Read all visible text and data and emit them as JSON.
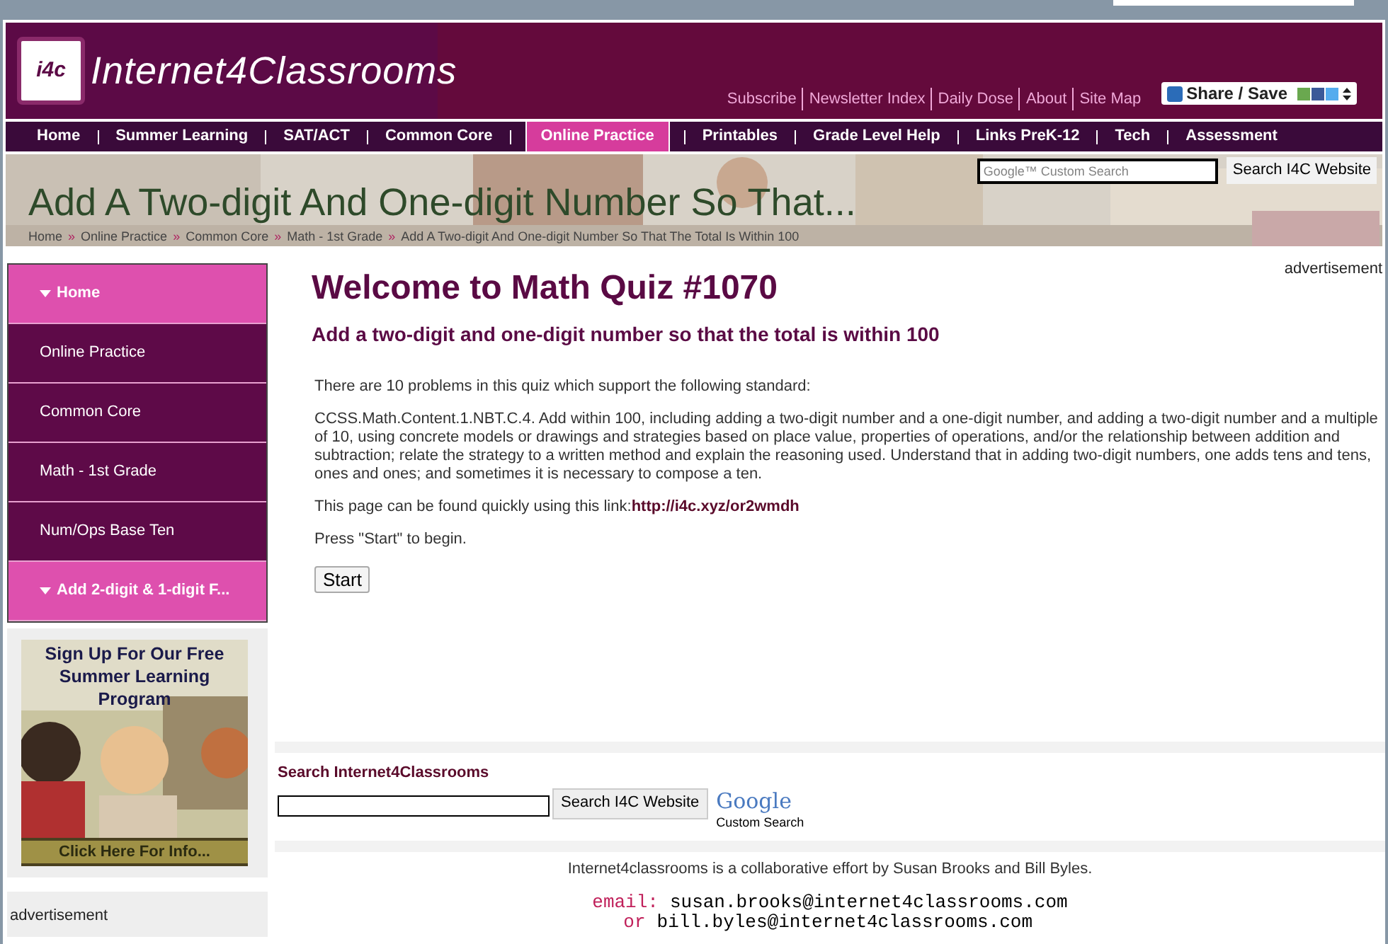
{
  "header": {
    "logo_badge": "i4c",
    "site_name": "Internet4Classrooms",
    "top_links": [
      "Subscribe",
      "Newsletter Index",
      "Daily Dose",
      "About",
      "Site Map"
    ],
    "share_button": "Share / Save"
  },
  "nav": [
    {
      "label": "Home",
      "selected": false
    },
    {
      "label": "Summer Learning",
      "selected": false
    },
    {
      "label": "SAT/ACT",
      "selected": false
    },
    {
      "label": "Common Core",
      "selected": false
    },
    {
      "label": "Online Practice",
      "selected": true
    },
    {
      "label": "Printables",
      "selected": false
    },
    {
      "label": "Grade Level Help",
      "selected": false
    },
    {
      "label": "Links PreK-12",
      "selected": false
    },
    {
      "label": "Tech",
      "selected": false
    },
    {
      "label": "Assessment",
      "selected": false
    }
  ],
  "banner": {
    "title": "Add A Two-digit And One-digit Number So That...",
    "search_placeholder": "Google™ Custom Search",
    "search_button": "Search I4C Website",
    "breadcrumb_separator": "»",
    "breadcrumb": [
      "Home",
      "Online Practice",
      "Common Core",
      "Math - 1st Grade",
      "Add A Two-digit And One-digit Number So That The Total Is Within 100"
    ]
  },
  "sidebar": {
    "items": [
      {
        "label": "Home",
        "highlighted": true
      },
      {
        "label": "Online Practice",
        "highlighted": false
      },
      {
        "label": "Common Core",
        "highlighted": false
      },
      {
        "label": "Math - 1st Grade",
        "highlighted": false
      },
      {
        "label": "Num/Ops Base Ten",
        "highlighted": false
      },
      {
        "label": "Add 2-digit & 1-digit F...",
        "highlighted": true
      }
    ],
    "promo": {
      "headline": "Sign Up For Our Free Summer Learning Program",
      "cta": "Click Here For Info..."
    },
    "ad_label": "advertisement"
  },
  "main": {
    "title": "Welcome to Math Quiz #1070",
    "subtitle": "Add a two-digit and one-digit number so that the total is within 100",
    "ad_label": "advertisement",
    "intro": "There are 10 problems in this quiz which support the following standard:",
    "standard": "CCSS.Math.Content.1.NBT.C.4. Add within 100, including adding a two-digit number and a one-digit number, and adding a two-digit number and a multiple of 10, using concrete models or drawings and strategies based on place value, properties of operations, and/or the relationship between addition and subtraction; relate the strategy to a written method and explain the reasoning used. Understand that in adding two-digit numbers, one adds tens and tens, ones and ones; and sometimes it is necessary to compose a ten.",
    "link_prefix": "This page can be found quickly using this link:",
    "link": "http://i4c.xyz/or2wmdh",
    "instruction": "Press \"Start\" to begin.",
    "start_button": "Start"
  },
  "site_search": {
    "heading": "Search Internet4Classrooms",
    "button": "Search I4C Website",
    "google_logo": "Google",
    "google_caption": "Custom Search"
  },
  "footer": {
    "credit": "Internet4classrooms is a collaborative effort by Susan Brooks and Bill Byles.",
    "email_label": "email:",
    "email_1": "susan.brooks@internet4classrooms.com",
    "or_label": "or",
    "email_2": "bill.byles@internet4classrooms.com"
  }
}
